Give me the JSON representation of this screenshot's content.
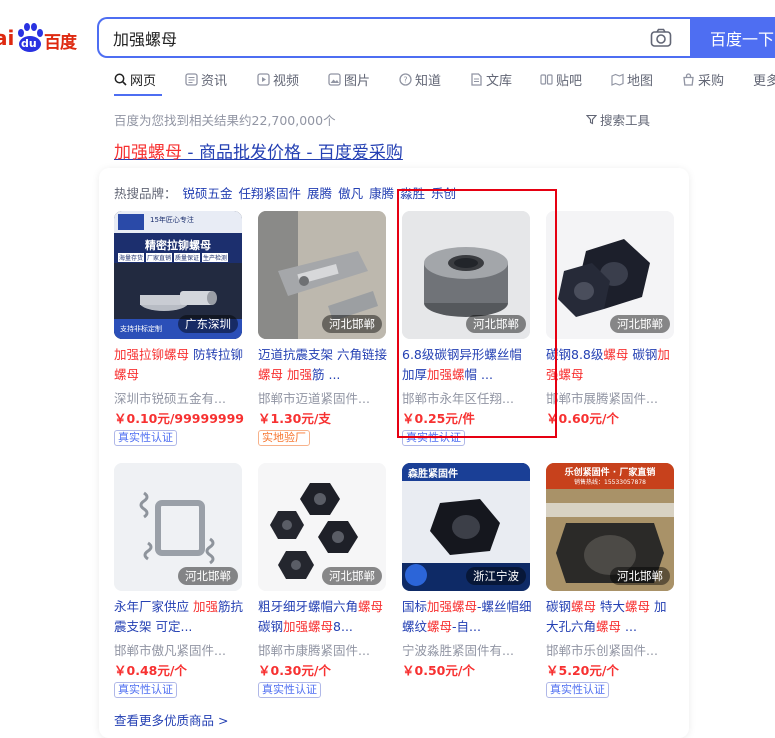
{
  "logo": {
    "ai": "ai",
    "du": "du",
    "baidu": "百度"
  },
  "search": {
    "query": "加强螺母",
    "button_label": "百度一下"
  },
  "tabs": [
    {
      "label": "网页"
    },
    {
      "label": "资讯"
    },
    {
      "label": "视频"
    },
    {
      "label": "图片"
    },
    {
      "label": "知道"
    },
    {
      "label": "文库"
    },
    {
      "label": "贴吧"
    },
    {
      "label": "地图"
    },
    {
      "label": "采购"
    },
    {
      "label": "更多"
    }
  ],
  "result_count": "百度为您找到相关结果约22,700,000个",
  "search_tools": "搜索工具",
  "title": {
    "highlight": "加强螺母",
    "rest": " - 商品批发价格 - 百度爱采购"
  },
  "brands": {
    "label": "热搜品牌：",
    "items": [
      "锐硕五金",
      "任翔紧固件",
      "展腾",
      "傲凡",
      "康腾",
      "淼胜",
      "乐创"
    ]
  },
  "products": [
    {
      "location": "广东深圳",
      "name_parts": [
        [
          "加强拉铆螺母",
          true
        ],
        [
          " 防转拉铆",
          false
        ],
        [
          "螺母",
          true
        ]
      ],
      "seller": "深圳市锐硕五金有...",
      "price": "￥0.10元/99999999",
      "badge": "真实性认证",
      "badge_style": "blue"
    },
    {
      "location": "河北邯郸",
      "name_parts": [
        [
          "迈道抗震支架 六角链接",
          false
        ],
        [
          "螺母",
          true
        ],
        [
          " ",
          false
        ],
        [
          "加强",
          true
        ],
        [
          "筋 ...",
          false
        ]
      ],
      "seller": "邯郸市迈道紧固件...",
      "price": "￥1.30元/支",
      "badge": "实地验厂",
      "badge_style": "orange"
    },
    {
      "location": "河北邯郸",
      "name_parts": [
        [
          "6.8级碳钢异形螺丝帽加厚",
          false
        ],
        [
          "加强螺",
          true
        ],
        [
          "帽 ...",
          false
        ]
      ],
      "seller": "邯郸市永年区任翔...",
      "price": "￥0.25元/件",
      "badge": "真实性认证",
      "badge_style": "blue"
    },
    {
      "location": "河北邯郸",
      "name_parts": [
        [
          "碳钢8.8级",
          false
        ],
        [
          "螺母",
          true
        ],
        [
          " 碳钢",
          false
        ],
        [
          "加强",
          true
        ],
        [
          "螺母",
          true
        ]
      ],
      "seller": "邯郸市展腾紧固件...",
      "price": "￥0.60元/个",
      "badge": "",
      "badge_style": "none"
    },
    {
      "location": "河北邯郸",
      "name_parts": [
        [
          "永年厂家供应 ",
          false
        ],
        [
          "加强",
          true
        ],
        [
          "筋抗震支架 可定...",
          false
        ]
      ],
      "seller": "邯郸市傲凡紧固件...",
      "price": "￥0.48元/个",
      "badge": "真实性认证",
      "badge_style": "blue"
    },
    {
      "location": "河北邯郸",
      "name_parts": [
        [
          "粗牙细牙螺帽六角",
          false
        ],
        [
          "螺母",
          true
        ],
        [
          "碳钢",
          false
        ],
        [
          "加强螺母",
          true
        ],
        [
          "8...",
          false
        ]
      ],
      "seller": "邯郸市康腾紧固件...",
      "price": "￥0.30元/个",
      "badge": "真实性认证",
      "badge_style": "blue"
    },
    {
      "location": "浙江宁波",
      "name_parts": [
        [
          "国标",
          false
        ],
        [
          "加强螺母",
          true
        ],
        [
          "-螺丝帽细螺纹",
          false
        ],
        [
          "螺母",
          true
        ],
        [
          "-自...",
          false
        ]
      ],
      "seller": "宁波淼胜紧固件有...",
      "price": "￥0.50元/个",
      "badge": "",
      "badge_style": "none"
    },
    {
      "location": "河北邯郸",
      "name_parts": [
        [
          "碳钢",
          false
        ],
        [
          "螺母",
          true
        ],
        [
          " 特大",
          false
        ],
        [
          "螺母",
          true
        ],
        [
          " 加大孔六角",
          false
        ],
        [
          "螺母",
          true
        ],
        [
          " ...",
          false
        ]
      ],
      "seller": "邯郸市乐创紧固件...",
      "price": "￥5.20元/个",
      "badge": "真实性认证",
      "badge_style": "blue"
    }
  ],
  "thumb_text": {
    "p1_title": "精密拉铆螺母",
    "p1_sub": "15年匠心专注",
    "p1_tags": [
      "海量存货",
      "厂家直销",
      "质量保证",
      "生产检测"
    ],
    "p1_bottom": "支持非标定制",
    "p7_title": "森胜紧固件",
    "p8_title": "乐创紧固件 · 厂家直销",
    "p8_phone": "销售热线：15533057878"
  },
  "more_link": "查看更多优质商品 >"
}
